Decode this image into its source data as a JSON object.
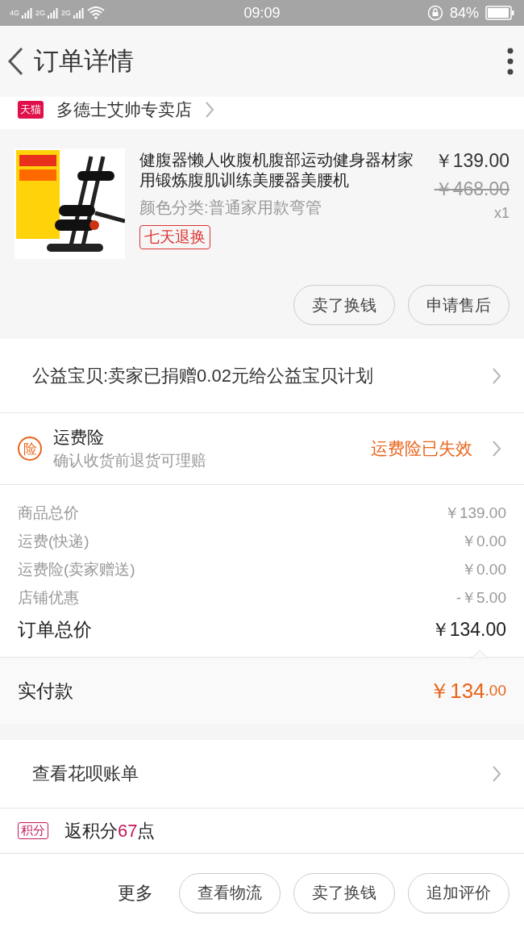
{
  "status_bar": {
    "network_labels": [
      "4G",
      "2G",
      "2G"
    ],
    "time": "09:09",
    "battery": "84%"
  },
  "header": {
    "title": "订单详情"
  },
  "shop": {
    "badge": "天猫",
    "name": "多德士艾帅专卖店"
  },
  "product": {
    "title": "健腹器懒人收腹机腹部运动健身器材家用锻炼腹肌训练美腰器美腰机",
    "variant": "颜色分类:普通家用款弯管",
    "tag": "七天退换",
    "price": "￥139.00",
    "original_price": "￥468.00",
    "quantity": "x1"
  },
  "item_actions": [
    "卖了换钱",
    "申请售后"
  ],
  "charity": {
    "text": "公益宝贝:卖家已捐赠0.02元给公益宝贝计划"
  },
  "insurance": {
    "badge": "险",
    "title": "运费险",
    "subtitle": "确认收货前退货可理赔",
    "status": "运费险已失效"
  },
  "charges": [
    {
      "label": "商品总价",
      "amount": "￥139.00"
    },
    {
      "label": "运费(快递)",
      "amount": "￥0.00"
    },
    {
      "label": "运费险(卖家赠送)",
      "amount": "￥0.00"
    },
    {
      "label": "店铺优惠",
      "amount": "-￥5.00"
    }
  ],
  "total": {
    "label": "订单总价",
    "amount": "￥134.00"
  },
  "paid": {
    "label": "实付款",
    "amount_main": "￥134",
    "amount_decimal": ".00"
  },
  "huabei": {
    "label": "查看花呗账单"
  },
  "points": {
    "badge": "积分",
    "prefix": "返积分",
    "value": "67",
    "suffix": "点"
  },
  "bottom_bar": {
    "more": "更多",
    "buttons": [
      "查看物流",
      "卖了换钱",
      "追加评价"
    ]
  }
}
